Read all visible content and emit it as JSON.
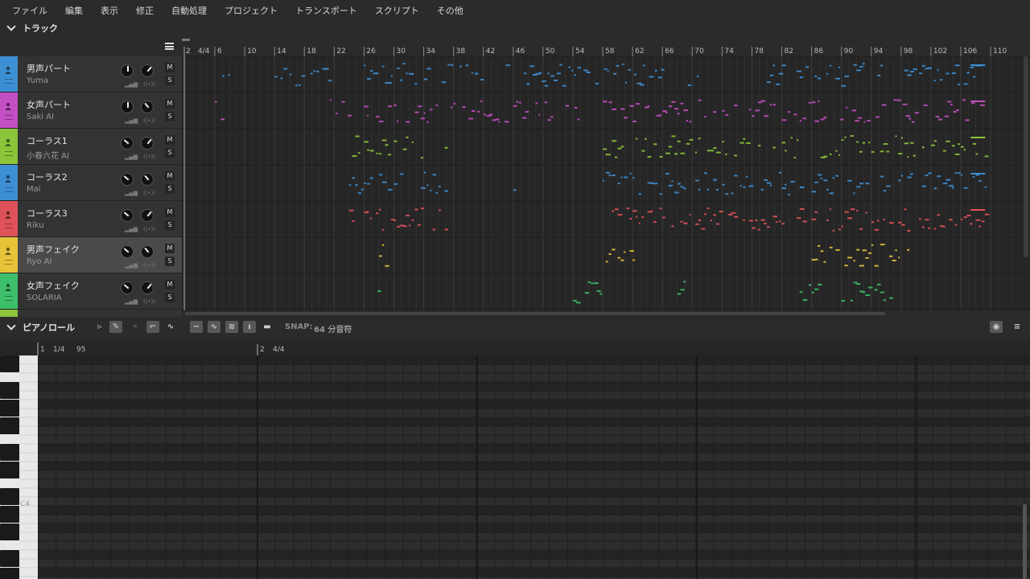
{
  "menu": [
    "ファイル",
    "編集",
    "表示",
    "修正",
    "自動処理",
    "プロジェクト",
    "トランスポート",
    "スクリプト",
    "その他"
  ],
  "tracks_section": {
    "title": "トラック"
  },
  "timeline": {
    "start_label": "2",
    "time_sig": "4/4",
    "ruler_labels": [
      "6",
      "10",
      "14",
      "18",
      "22",
      "26",
      "30",
      "34",
      "38",
      "42",
      "46",
      "50",
      "54",
      "58",
      "62",
      "66",
      "70",
      "74",
      "78",
      "82",
      "86",
      "90",
      "94",
      "98",
      "102",
      "106",
      "110"
    ]
  },
  "tracks": [
    {
      "name": "男声パート",
      "singer": "Yuma",
      "color": "#3d8fd4",
      "selected": false
    },
    {
      "name": "女声パート",
      "singer": "Saki AI",
      "color": "#c44fc4",
      "selected": false
    },
    {
      "name": "コーラス1",
      "singer": "小春六花 AI",
      "color": "#8cc43a",
      "selected": false
    },
    {
      "name": "コーラス2",
      "singer": "Mai",
      "color": "#3d8fd4",
      "selected": false
    },
    {
      "name": "コーラス3",
      "singer": "Riku",
      "color": "#e0525a",
      "selected": false
    },
    {
      "name": "男声フェイク",
      "singer": "Ryo AI",
      "color": "#e6c43a",
      "selected": true
    },
    {
      "name": "女声フェイク",
      "singer": "SOLARIA",
      "color": "#3dbf6a",
      "selected": false
    }
  ],
  "track_buttons": {
    "mute": "M",
    "solo": "S"
  },
  "piano_roll": {
    "title": "ピアノロール",
    "snap_label": "SNAP:",
    "snap_value": "64 分音符",
    "ruler": {
      "bar1": "1",
      "sig": "1/4",
      "tempo": "95",
      "bar2": "2",
      "sig2": "4/4"
    },
    "key_label": "C4"
  },
  "colors": {
    "background": "#2a2a2a",
    "panel": "#333333",
    "selected": "#4a4a4a"
  }
}
